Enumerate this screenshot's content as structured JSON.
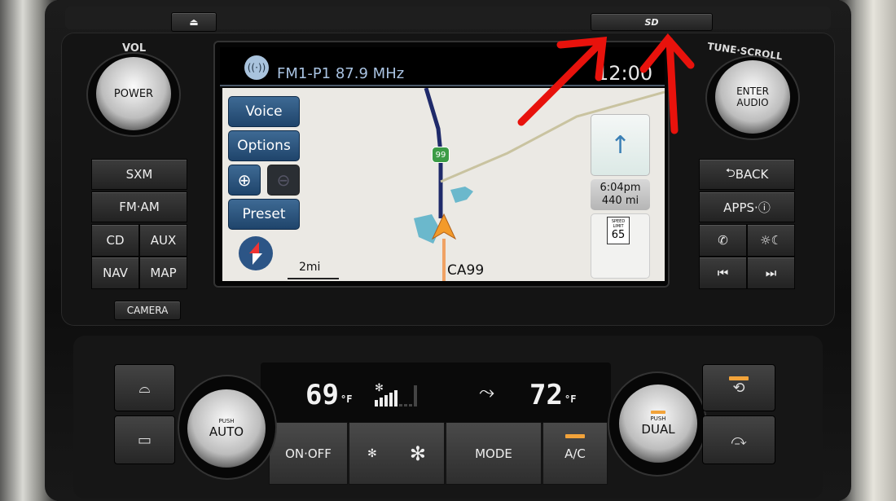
{
  "head_unit": {
    "eject_icon": "eject-icon",
    "sd_slot_label": "SD",
    "vol_label": "VOL",
    "power_label": "POWER",
    "tune_label": "TUNE·SCROLL",
    "enter_label": "ENTER",
    "audio_label": "AUDIO",
    "left_buttons": {
      "sxm": "SXM",
      "fm_am": "FM·AM",
      "cd": "CD",
      "aux": "AUX",
      "nav": "NAV",
      "map": "MAP",
      "camera": "CAMERA"
    },
    "right_buttons": {
      "back": "BACK",
      "apps": "APPS·ⓘ",
      "phone_icon": "phone-icon",
      "brightness_icon": "brightness-icon",
      "prev_icon": "skip-back-icon",
      "next_icon": "skip-forward-icon"
    }
  },
  "screen": {
    "header": {
      "radio_icon": "broadcast-icon",
      "station": "FM1-P1 87.9 MHz",
      "clock": "12:00"
    },
    "nav_buttons": {
      "voice": "Voice",
      "options": "Options",
      "zoom_in_icon": "zoom-in-icon",
      "zoom_out_icon": "zoom-out-icon",
      "preset": "Preset",
      "compass_icon": "compass-icon"
    },
    "map": {
      "scale": "2mi",
      "road_name": "CA99",
      "route_shield": "99"
    },
    "guidance": {
      "direction_icon": "arrow-up-icon",
      "eta": "6:04pm",
      "distance": "440 mi",
      "speed_limit_label": "SPEED LIMIT",
      "speed_limit": "65"
    }
  },
  "climate": {
    "left_temp": "69",
    "left_unit": "°F",
    "right_temp": "72",
    "right_unit": "°F",
    "fan_level": 5,
    "fan_level_max": 9,
    "buttons": {
      "on_off": "ON·OFF",
      "mode": "MODE",
      "ac": "A/C",
      "push_auto": "PUSH",
      "auto": "AUTO",
      "push_dual": "PUSH",
      "dual": "DUAL"
    },
    "ac_indicator_color": "#f2a33a"
  },
  "annotation": {
    "arrow_color": "#e8120c"
  }
}
